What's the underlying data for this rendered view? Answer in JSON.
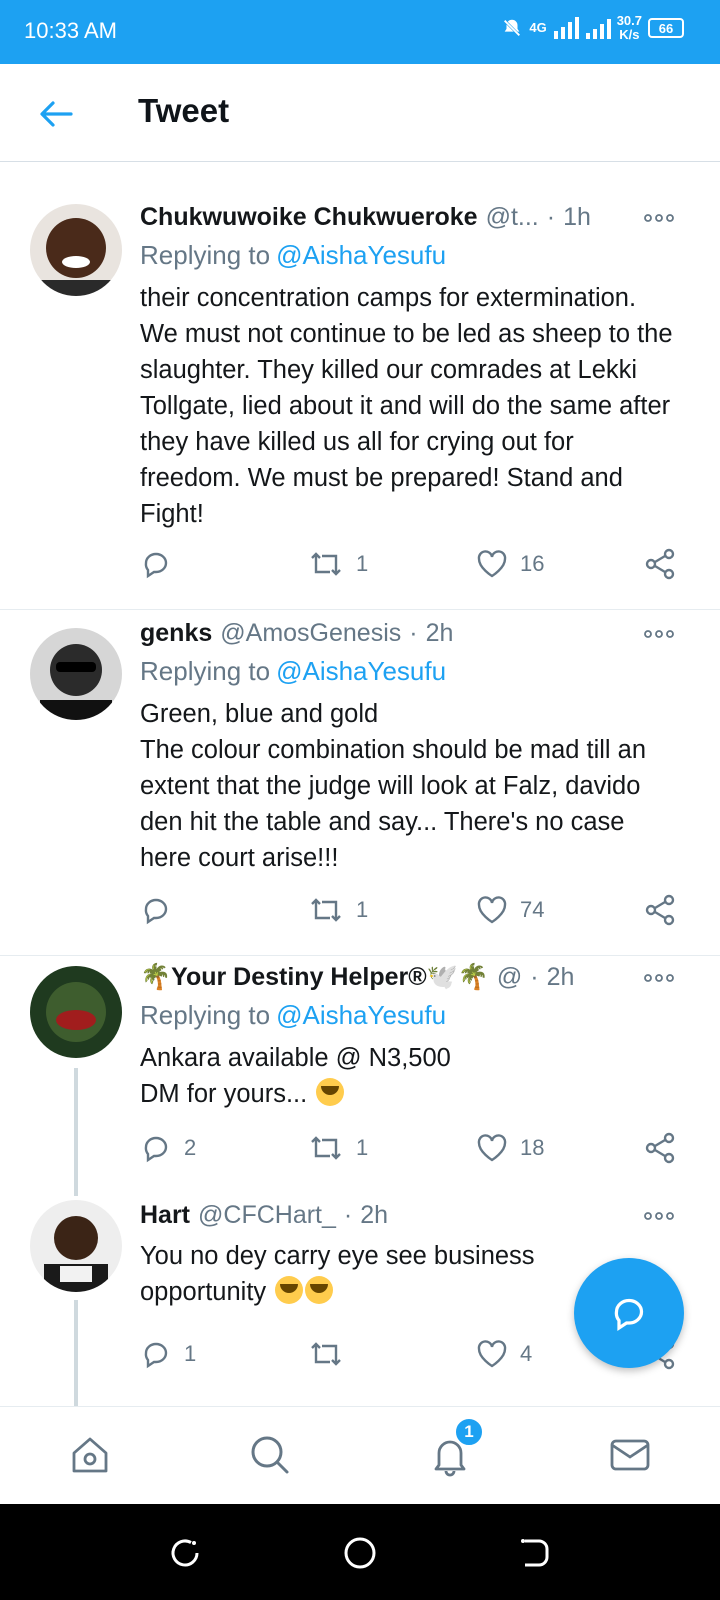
{
  "status": {
    "time": "10:33 AM",
    "network_top": "4G",
    "speed_top": "30.7",
    "speed_unit": "K/s",
    "battery": "66"
  },
  "header": {
    "title": "Tweet"
  },
  "tweets": [
    {
      "name": "Chukwuwoike Chukwueroke",
      "handle": "@t...",
      "dot": "·",
      "time": "1h",
      "replying_label": "Replying to",
      "replying_to": "@AishaYesufu",
      "text": "their concentration camps for extermination. We must not continue to be led as sheep to the slaughter. They killed our comrades at Lekki Tollgate, lied about it and will do the same after they have killed us all for crying out for freedom. We must be prepared! Stand and Fight!",
      "replies": "",
      "retweets": "1",
      "likes": "16"
    },
    {
      "name": "genks",
      "handle": "@AmosGenesis",
      "dot": "·",
      "time": "2h",
      "replying_label": "Replying to",
      "replying_to": "@AishaYesufu",
      "text_line1": "Green, blue and gold",
      "text": "The colour combination should be mad till an extent that the judge will look at Falz, davido den hit the table and say... There's no case here court arise!!!",
      "replies": "",
      "retweets": "1",
      "likes": "74"
    },
    {
      "name": "🌴Your Destiny Helper®🕊️🌴",
      "handle": "@",
      "dot": "·",
      "time": "2h",
      "replying_label": "Replying to",
      "replying_to": "@AishaYesufu",
      "text_line1": "Ankara available @ N3,500",
      "text": "DM for yours...",
      "replies": "2",
      "retweets": "1",
      "likes": "18"
    },
    {
      "name": "Hart",
      "handle": "@CFCHart_",
      "dot": "·",
      "time": "2h",
      "text": "You no dey carry eye see business opportunity",
      "replies": "1",
      "retweets": "",
      "likes": "4"
    }
  ],
  "notifications_badge": "1",
  "colors": {
    "accent": "#1da1f2",
    "muted": "#657786",
    "text": "#14171a"
  }
}
